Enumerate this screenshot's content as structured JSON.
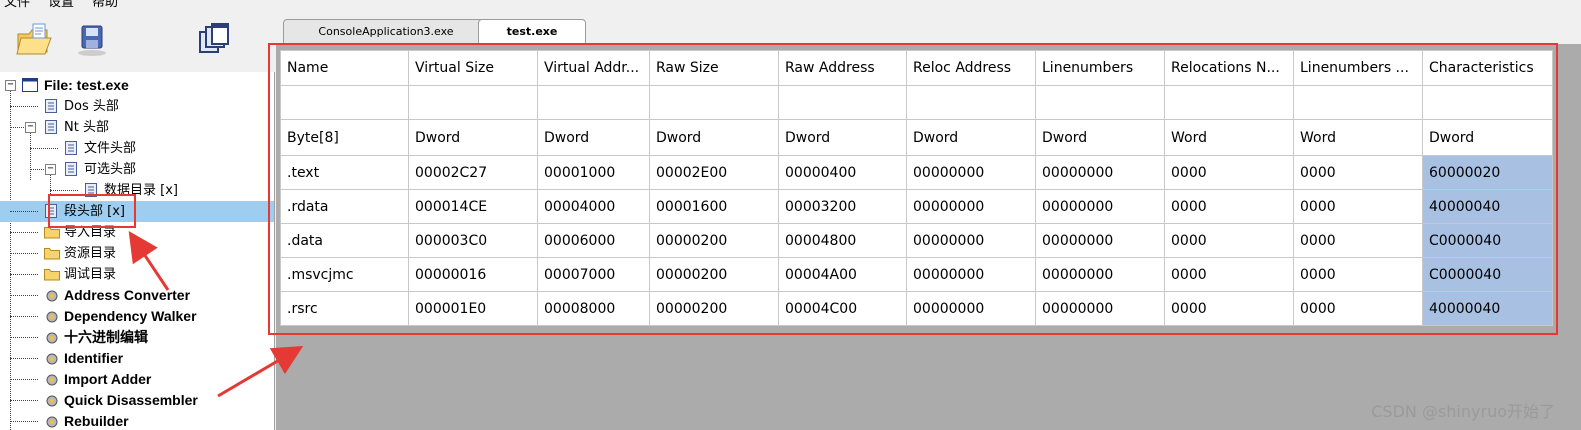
{
  "menu": [
    "文件",
    "设置",
    "帮助"
  ],
  "toolbar": {
    "icons": [
      "open-folder-icon",
      "save-disk-icon",
      "windows-icon"
    ]
  },
  "tabs": [
    {
      "label": "ConsoleApplication3.exe",
      "active": false
    },
    {
      "label": "test.exe",
      "active": true
    }
  ],
  "tree": {
    "root": "File: test.exe",
    "items": [
      {
        "label": "Dos 头部"
      },
      {
        "label": "Nt 头部"
      },
      {
        "label": "文件头部"
      },
      {
        "label": "可选头部"
      },
      {
        "label": "数据目录 [x]"
      },
      {
        "label": "段头部 [x]",
        "selected": true
      },
      {
        "label": "导入目录"
      },
      {
        "label": "资源目录"
      },
      {
        "label": "调试目录"
      },
      {
        "label": "Address Converter"
      },
      {
        "label": "Dependency Walker"
      },
      {
        "label": "十六进制编辑"
      },
      {
        "label": "Identifier"
      },
      {
        "label": "Import Adder"
      },
      {
        "label": "Quick Disassembler"
      },
      {
        "label": "Rebuilder"
      }
    ]
  },
  "grid": {
    "headers": [
      "Name",
      "Virtual Size",
      "Virtual Addr...",
      "Raw Size",
      "Raw Address",
      "Reloc Address",
      "Linenumbers",
      "Relocations N...",
      "Linenumbers ...",
      "Characteristics"
    ],
    "types": [
      "Byte[8]",
      "Dword",
      "Dword",
      "Dword",
      "Dword",
      "Dword",
      "Dword",
      "Word",
      "Word",
      "Dword"
    ],
    "rows": [
      [
        ".text",
        "00002C27",
        "00001000",
        "00002E00",
        "00000400",
        "00000000",
        "00000000",
        "0000",
        "0000",
        "60000020"
      ],
      [
        ".rdata",
        "000014CE",
        "00004000",
        "00001600",
        "00003200",
        "00000000",
        "00000000",
        "0000",
        "0000",
        "40000040"
      ],
      [
        ".data",
        "000003C0",
        "00006000",
        "00000200",
        "00004800",
        "00000000",
        "00000000",
        "0000",
        "0000",
        "C0000040"
      ],
      [
        ".msvcjmc",
        "00000016",
        "00007000",
        "00000200",
        "00004A00",
        "00000000",
        "00000000",
        "0000",
        "0000",
        "C0000040"
      ],
      [
        ".rsrc",
        "000001E0",
        "00008000",
        "00000200",
        "00004C00",
        "00000000",
        "00000000",
        "0000",
        "0000",
        "40000040"
      ]
    ]
  },
  "colors": {
    "annotation_red": "#e53935",
    "selected_tree": "#9fcdf0",
    "characteristics_cell": "#a8c0e2"
  },
  "watermark": "CSDN @shinyruo开始了"
}
